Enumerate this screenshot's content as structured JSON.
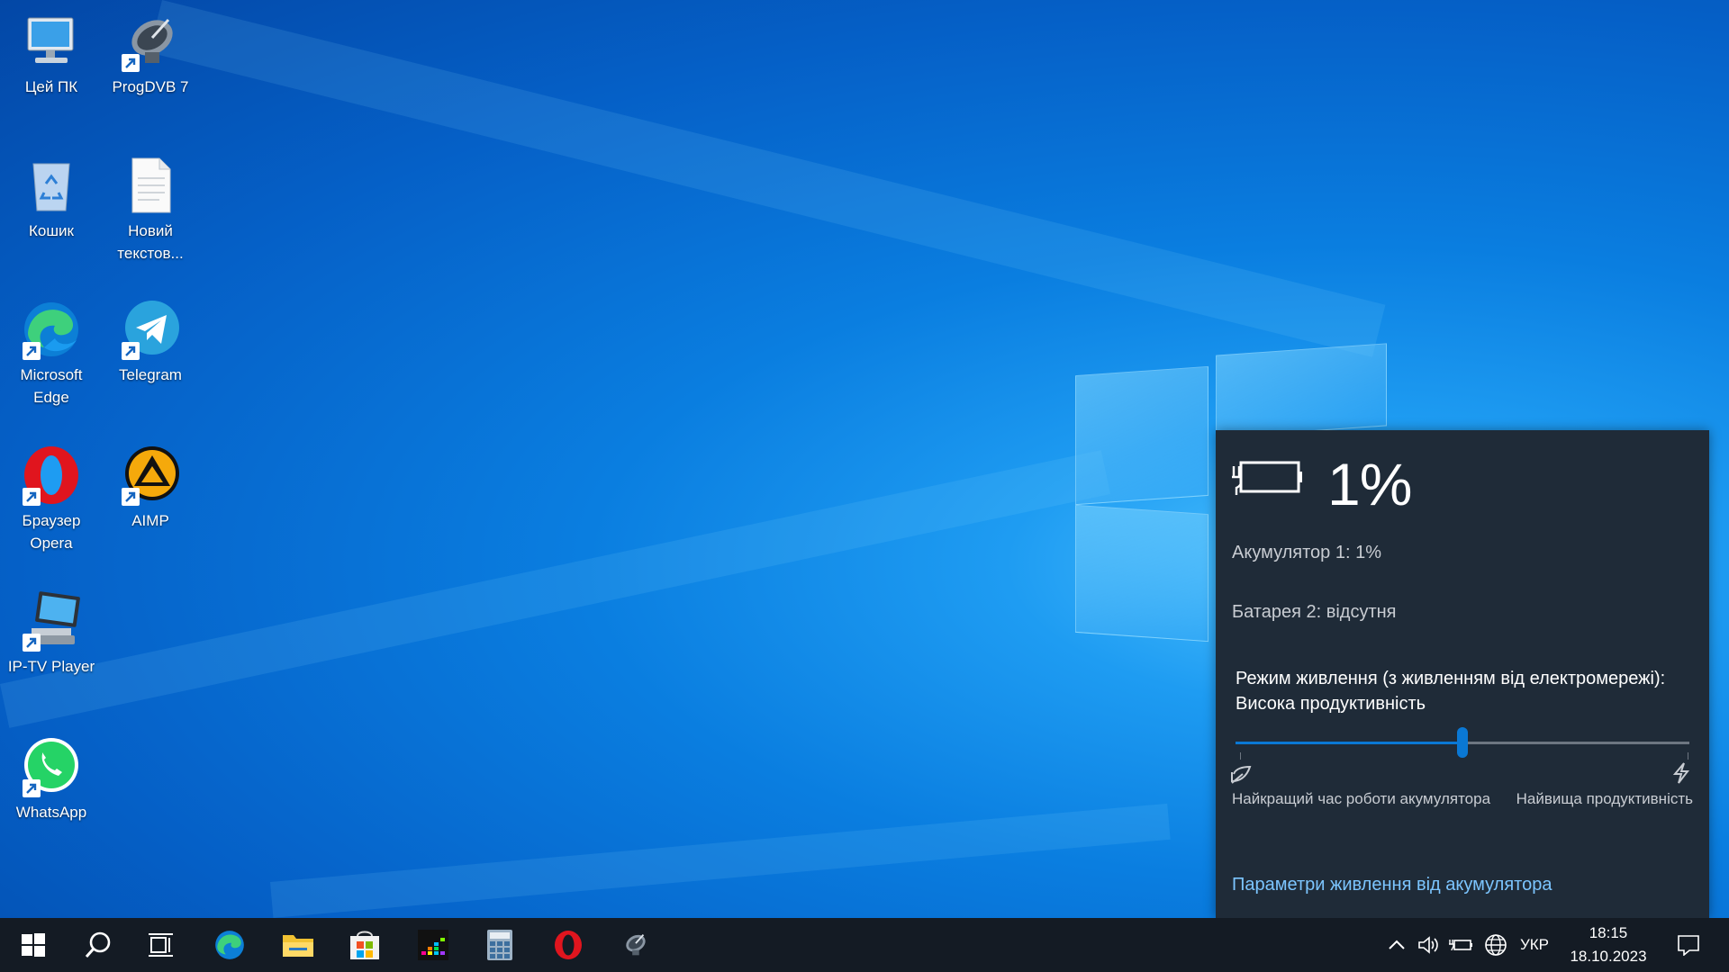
{
  "desktop": {
    "icons": [
      {
        "label": "Цей ПК",
        "icon": "this-pc-icon"
      },
      {
        "label": "ProgDVB 7",
        "icon": "progdvb-icon"
      },
      {
        "label": "Кошик",
        "icon": "recycle-bin-icon"
      },
      {
        "label": "Новий текстов...",
        "icon": "text-document-icon"
      },
      {
        "label": "Microsoft Edge",
        "icon": "edge-icon"
      },
      {
        "label": "Telegram",
        "icon": "telegram-icon"
      },
      {
        "label": "Браузер Opera",
        "icon": "opera-icon"
      },
      {
        "label": "AIMP",
        "icon": "aimp-icon"
      },
      {
        "label": "IP-TV Player",
        "icon": "iptv-player-icon"
      },
      {
        "label": "WhatsApp",
        "icon": "whatsapp-icon"
      }
    ]
  },
  "battery_flyout": {
    "percent": "1%",
    "battery1": "Акумулятор 1: 1%",
    "battery2": "Батарея 2: відсутня",
    "mode_line1": "Режим живлення (з живленням від електромережі):",
    "mode_line2": "Висока продуктивність",
    "slider_value_fraction": 0.5,
    "left_label": "Найкращий час роботи акумулятора",
    "right_label": "Найвища продуктивність",
    "settings_link": "Параметри живлення від акумулятора",
    "accent_color": "#0a78d4",
    "link_color": "#7cc5ff"
  },
  "taskbar": {
    "apps": [
      "start-icon",
      "search-icon",
      "task-view-icon",
      "edge-icon",
      "file-explorer-icon",
      "store-icon",
      "deezer-icon",
      "calculator-icon",
      "opera-icon",
      "progdvb-icon"
    ],
    "language": "УКР",
    "time": "18:15",
    "date": "18.10.2023"
  }
}
